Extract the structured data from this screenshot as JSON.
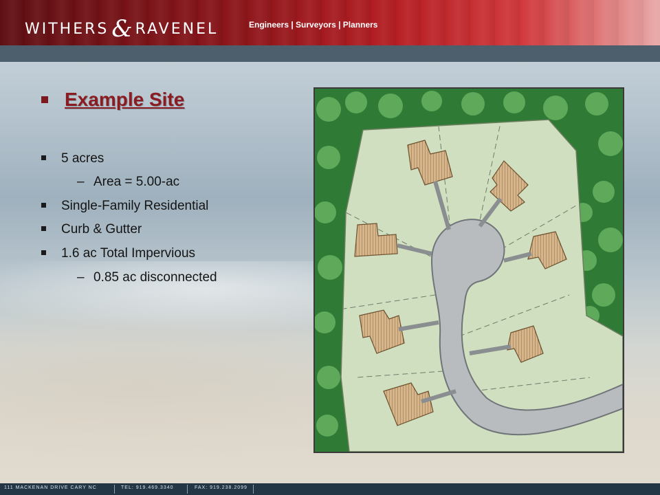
{
  "header": {
    "logo_left": "WITHERS",
    "logo_amp": "&",
    "logo_right": "RAVENEL",
    "tagline": "Engineers | Surveyors | Planners"
  },
  "slide": {
    "title": "Example Site",
    "bullets": [
      {
        "text": "5 acres",
        "sub": [
          "Area = 5.00-ac"
        ]
      },
      {
        "text": "Single-Family Residential"
      },
      {
        "text": "Curb & Gutter"
      },
      {
        "text": "1.6 ac Total Impervious",
        "sub": [
          "0.85 ac disconnected"
        ]
      }
    ]
  },
  "footer": {
    "address": "111 MACKENAN DRIVE   CARY  NC",
    "tel": "TEL: 919.469.3340",
    "fax": "FAX: 919.238.2099"
  },
  "colors": {
    "brand_red": "#8b1c21",
    "band": "#4d5f6c",
    "footer": "#233646"
  }
}
